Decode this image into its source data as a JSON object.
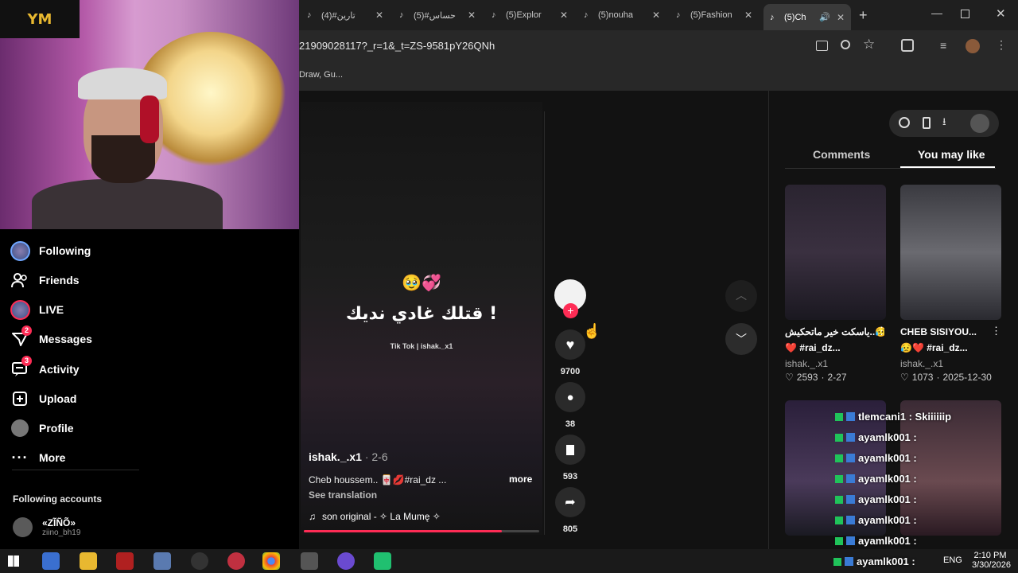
{
  "overlay": {
    "logo_text": "YM"
  },
  "sidebar": {
    "items": [
      {
        "label": "Following"
      },
      {
        "label": "Friends"
      },
      {
        "label": "LIVE"
      },
      {
        "label": "Messages",
        "badge": "2"
      },
      {
        "label": "Activity",
        "badge": "3"
      },
      {
        "label": "Upload"
      },
      {
        "label": "Profile"
      },
      {
        "label": "More"
      }
    ],
    "following_heading": "Following accounts",
    "account": {
      "name": "«ZĨÑÕ»",
      "handle": "ziino_bh19"
    }
  },
  "browser": {
    "tabs": [
      {
        "title": "تارين#(4)"
      },
      {
        "title": "حساس#(5)"
      },
      {
        "title": "(5)Explor"
      },
      {
        "title": "(5)nouha"
      },
      {
        "title": "(5)Fashion"
      },
      {
        "title": "(5)Ch"
      }
    ],
    "url": "21909028117?_r=1&_t=ZS-9581pY26QNh",
    "bookmarks_text": "Draw, Gu..."
  },
  "video": {
    "caption_emoji": "🥹💞",
    "caption_text": "قتلك غادي نديك !",
    "watermark": "Tik Tok | ishak._x1",
    "author": "ishak._.x1",
    "date": "2-6",
    "description": "Cheb houssem.. 🀄💋#rai_dz ...",
    "more_label": "more",
    "translation_label": "See translation",
    "sound": "son original - ✧ La Mumę ✧",
    "progress": 0.84
  },
  "actions": {
    "likes": "9700",
    "comments": "38",
    "saves": "593",
    "shares": "805"
  },
  "right_panel": {
    "tabs": [
      "Comments",
      "You may like"
    ],
    "active_tab": "You may like",
    "cards": [
      {
        "title": "ياسكت خير ماتحكيش..😥",
        "tags": "❤️ #rai_dz...",
        "author": "ishak._.x1",
        "likes": "2593",
        "date": "2-27"
      },
      {
        "title": "CHEB SISIYOU...",
        "tags": "😥❤️ #rai_dz...",
        "author": "ishak._.x1",
        "likes": "1073",
        "date": "2025-12-30"
      }
    ]
  },
  "chat": [
    {
      "text": "tlemcani1 : Skiiiiiip"
    },
    {
      "text": "ayamlk001 :"
    },
    {
      "text": "ayamlk001 :"
    },
    {
      "text": "ayamlk001 :"
    },
    {
      "text": "ayamlk001 :"
    },
    {
      "text": "ayamlk001 :"
    },
    {
      "text": "ayamlk001 :"
    },
    {
      "text": "ayamlk001 :"
    }
  ],
  "taskbar": {
    "lang": "ENG",
    "time": "2:10 PM",
    "date": "3/30/2026"
  },
  "colors": {
    "accent": "#fe2c55",
    "bg": "#121212"
  }
}
